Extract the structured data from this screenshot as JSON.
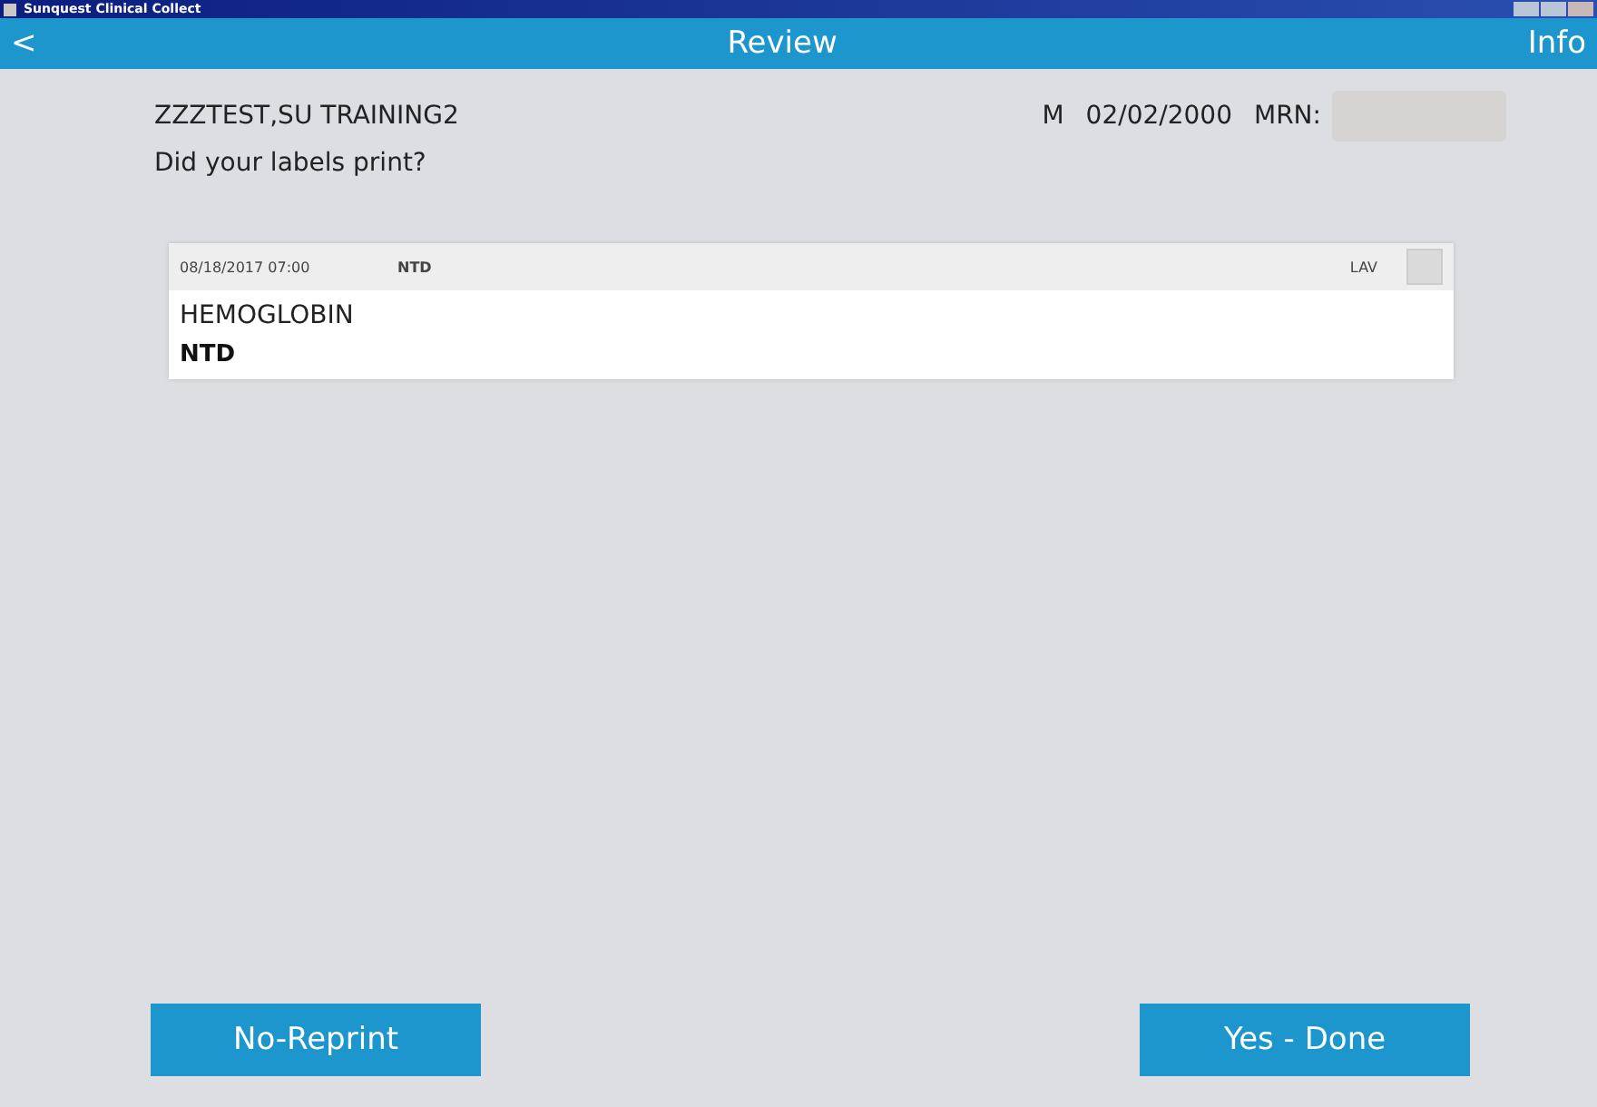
{
  "window": {
    "title": "Sunquest Clinical Collect"
  },
  "nav": {
    "back": "<",
    "title": "Review",
    "info": "Info"
  },
  "patient": {
    "name": "ZZZTEST,SU TRAINING2",
    "sex": "M",
    "dob": "02/02/2000",
    "mrn_label": "MRN:"
  },
  "prompt": "Did your labels print?",
  "orders": [
    {
      "datetime": "08/18/2017 07:00",
      "code": "NTD",
      "tube": "LAV",
      "checked": false,
      "test": "HEMOGLOBIN",
      "priority": "NTD"
    }
  ],
  "buttons": [
    {
      "label": "No-Reprint"
    },
    {
      "label": "Yes - Done"
    }
  ]
}
